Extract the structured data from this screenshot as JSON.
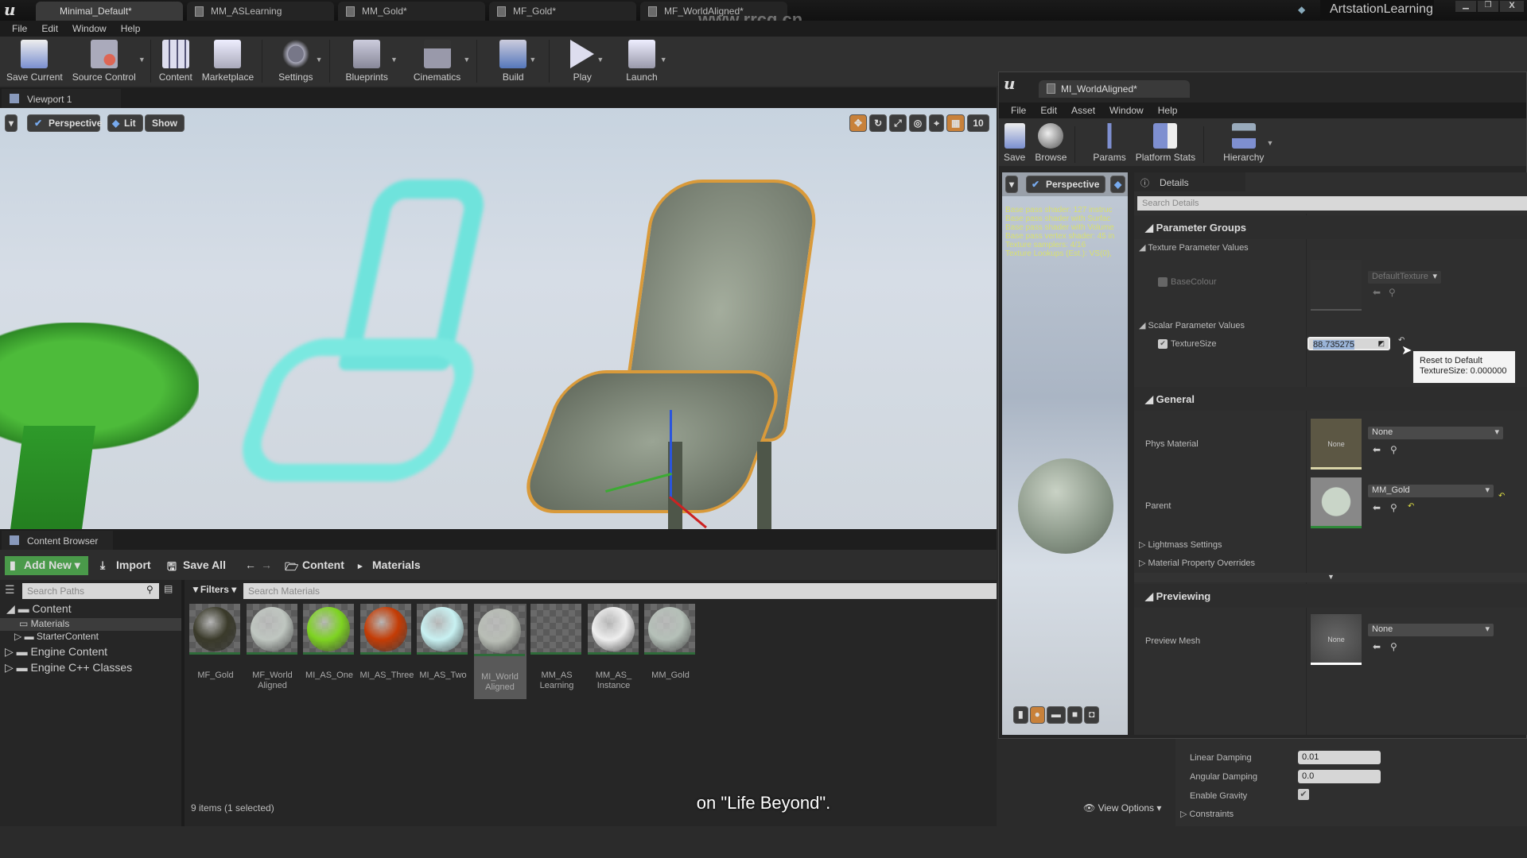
{
  "main_window": {
    "tabs": [
      "Minimal_Default*",
      "MM_ASLearning",
      "MM_Gold*",
      "MF_Gold*",
      "MF_WorldAligned*"
    ],
    "project_name": "ArtstationLearning",
    "menu": [
      "File",
      "Edit",
      "Window",
      "Help"
    ],
    "toolbar": [
      "Save Current",
      "Source Control",
      "Content",
      "Marketplace",
      "Settings",
      "Blueprints",
      "Cinematics",
      "Build",
      "Play",
      "Launch"
    ],
    "watermark_url": "www.rrcg.cn"
  },
  "viewport": {
    "tab": "Viewport 1",
    "perspective": "Perspective",
    "lit": "Lit",
    "show": "Show",
    "grid_snap": "10"
  },
  "content_browser": {
    "tab": "Content Browser",
    "add_new": "Add New",
    "import": "Import",
    "save_all": "Save All",
    "breadcrumb": [
      "Content",
      "Materials"
    ],
    "search_paths_placeholder": "Search Paths",
    "filters": "Filters",
    "search_materials_placeholder": "Search Materials",
    "tree": [
      "Content",
      "Materials",
      "StarterContent",
      "Engine Content",
      "Engine C++ Classes"
    ],
    "assets": [
      {
        "name": "MF_Gold",
        "color": "#3a3a2a"
      },
      {
        "name": "MF_World Aligned",
        "color": "#bfc6c0"
      },
      {
        "name": "MI_AS_One",
        "color": "#7ed321"
      },
      {
        "name": "MI_AS_Three",
        "color": "#c43c05"
      },
      {
        "name": "MI_AS_Two",
        "color": "#c8f1f2"
      },
      {
        "name": "MI_World Aligned",
        "color": "#b8bdb5",
        "selected": true
      },
      {
        "name": "MM_AS Learning",
        "color": ""
      },
      {
        "name": "MM_AS_ Instance",
        "color": "#eeeeee"
      },
      {
        "name": "MM_Gold",
        "color": "#b5c0b8"
      }
    ],
    "status": "9 items (1 selected)",
    "view_options": "View Options"
  },
  "material_editor": {
    "tab": "MI_WorldAligned*",
    "menu": [
      "File",
      "Edit",
      "Asset",
      "Window",
      "Help"
    ],
    "toolbar": [
      "Save",
      "Browse",
      "Params",
      "Platform Stats",
      "Hierarchy"
    ],
    "preview_perspective": "Perspective",
    "stats": [
      "Base pass shader: 127 instruc",
      "Base pass shader with Surfac",
      "Base pass shader with Volume",
      "Base pass vertex shader: 45 in",
      "Texture samplers: 4/16",
      "Texture Lookups (Est.): VS(0),"
    ],
    "details": {
      "tab": "Details",
      "search_placeholder": "Search Details",
      "parameter_groups": "Parameter Groups",
      "texture_params": "Texture Parameter Values",
      "base_colour": "BaseColour",
      "default_texture": "DefaultTexture",
      "scalar_params": "Scalar Parameter Values",
      "texture_size_label": "TextureSize",
      "texture_size_value": "88.735275",
      "texture_size_checked": true,
      "tooltip_line1": "Reset to Default",
      "tooltip_line2": "TextureSize: 0.000000",
      "general": "General",
      "phys_material": "Phys Material",
      "phys_material_value": "None",
      "parent": "Parent",
      "parent_value": "MM_Gold",
      "lightmass": "Lightmass Settings",
      "overrides": "Material Property Overrides",
      "previewing": "Previewing",
      "preview_mesh": "Preview Mesh",
      "preview_mesh_value": "None",
      "thumb_none": "None"
    }
  },
  "background_details": {
    "linear_damping_label": "Linear Damping",
    "linear_damping": "0.01",
    "angular_damping_label": "Angular Damping",
    "angular_damping": "0.0",
    "enable_gravity_label": "Enable Gravity",
    "enable_gravity": true,
    "constraints": "Constraints"
  },
  "subtitle": "on \"Life Beyond\".",
  "colors": {
    "accent_green": "#4a9a4a",
    "selection_orange": "#c8813a"
  }
}
